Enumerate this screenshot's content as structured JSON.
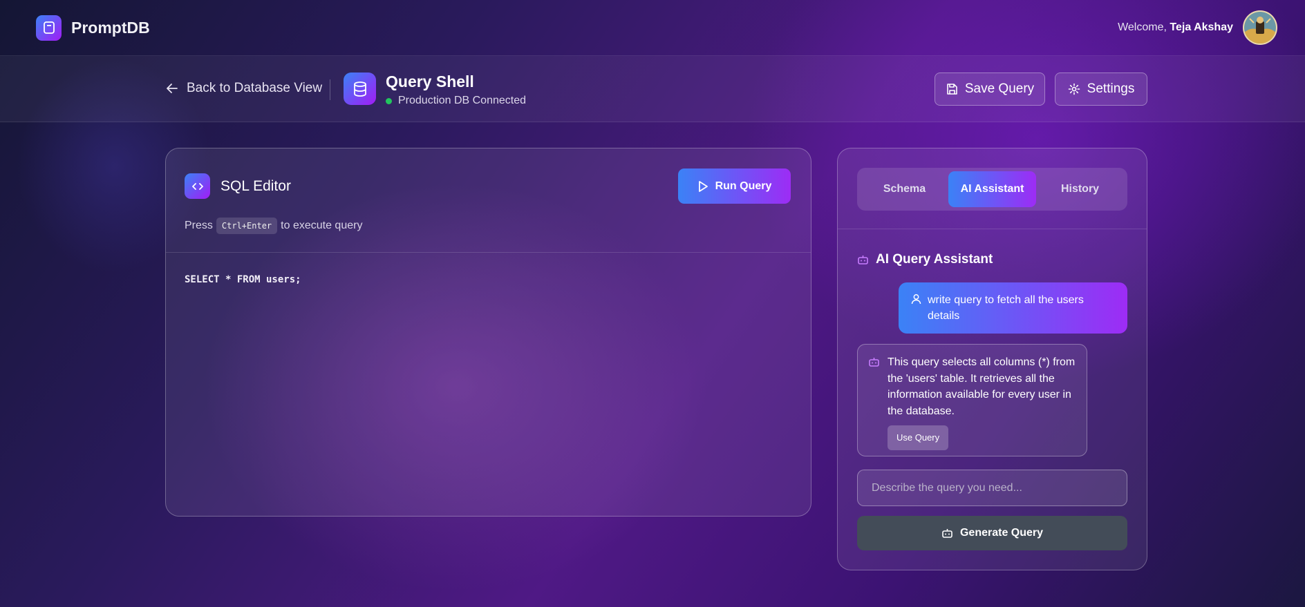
{
  "app": {
    "name": "PromptDB"
  },
  "user": {
    "welcome": "Welcome,",
    "name": "Teja Akshay"
  },
  "header": {
    "back_label": "Back to Database View",
    "title": "Query Shell",
    "status": "Production DB Connected",
    "save_label": "Save Query",
    "settings_label": "Settings"
  },
  "editor": {
    "title": "SQL Editor",
    "run_label": "Run Query",
    "hint_prefix": "Press",
    "hint_key": "Ctrl+Enter",
    "hint_suffix": "to execute query",
    "code": "SELECT * FROM users;"
  },
  "assistant": {
    "tabs": [
      {
        "label": "Schema",
        "active": false
      },
      {
        "label": "AI Assistant",
        "active": true
      },
      {
        "label": "History",
        "active": false
      }
    ],
    "title": "AI Query Assistant",
    "user_message": "write query to fetch all the users details",
    "bot_message": "This query selects all columns (*) from the 'users' table. It retrieves all the information available for every user in the database.",
    "use_query_label": "Use Query",
    "input_placeholder": "Describe the query you need...",
    "generate_label": "Generate Query"
  },
  "colors": {
    "accent_start": "#3b82f6",
    "accent_end": "#9d2cf5",
    "status_green": "#22c55e"
  }
}
